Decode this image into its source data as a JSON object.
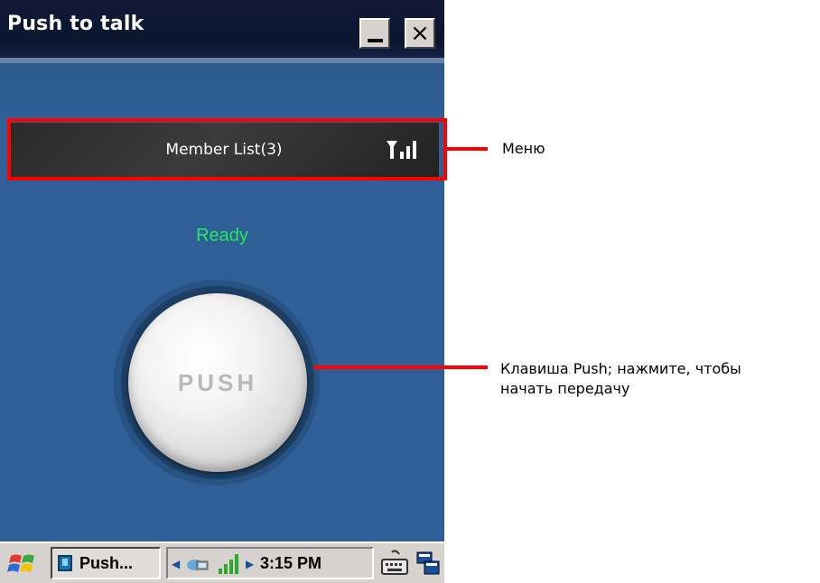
{
  "window": {
    "title": "Push to talk"
  },
  "menu": {
    "label": "Member List(3)",
    "signal_icon": "signal-strength-icon"
  },
  "status": {
    "text": "Ready",
    "color": "#27e85a"
  },
  "push_button": {
    "label": "PUSH"
  },
  "taskbar": {
    "start_icon": "windows-start-icon",
    "task_label": "Push...",
    "clock": "3:15 PM",
    "tray_icons": [
      "network-icon",
      "signal-bars-icon"
    ],
    "keyboard_icon": "keyboard-icon",
    "desktop_icon": "desktop-icon"
  },
  "callouts": {
    "menu": "Меню",
    "push_line1": "Клавиша Push; нажмите, чтобы",
    "push_line2": "начать передачу",
    "color": "#ff0000"
  },
  "colors": {
    "background": "#2f5f96",
    "titlebar": "#0a1530",
    "accent_red": "#ff0000"
  }
}
